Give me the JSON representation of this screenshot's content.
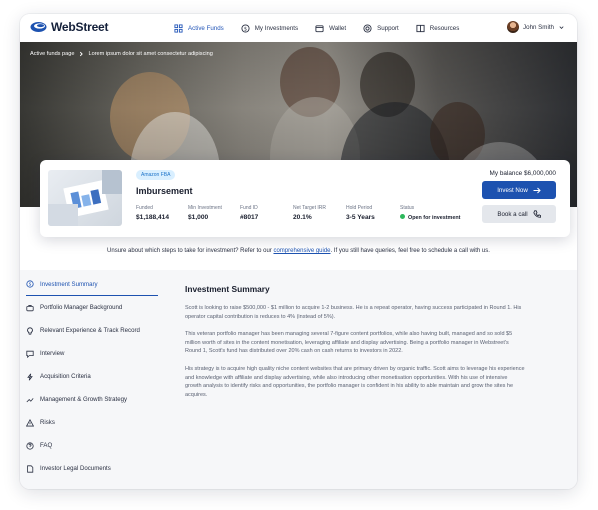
{
  "colors": {
    "brand": "#1d52b0",
    "status_open": "#2eb85c",
    "tag_bg": "#d9efff"
  },
  "nav": {
    "logo_text": "WebStreet",
    "items": [
      {
        "label": "Active Funds",
        "icon": "grid-icon",
        "active": true
      },
      {
        "label": "My Investments",
        "icon": "dollar-circle-icon"
      },
      {
        "label": "Wallet",
        "icon": "wallet-icon"
      },
      {
        "label": "Support",
        "icon": "lifebuoy-icon"
      },
      {
        "label": "Resources",
        "icon": "book-icon"
      }
    ],
    "user_name": "John Smith"
  },
  "breadcrumb": {
    "parent": "Active funds page",
    "current": "Lorem ipsum dolor sit amet consectetur adipiscing"
  },
  "fund": {
    "tag": "Amazon FBA",
    "title": "Imbursement",
    "stats": [
      {
        "label": "Funded",
        "value": "$1,188,414"
      },
      {
        "label": "Min Investment",
        "value": "$1,000"
      },
      {
        "label": "Fund ID",
        "value": "#8017"
      },
      {
        "label": "Net Target IRR",
        "value": "20.1%"
      },
      {
        "label": "Hold Period",
        "value": "3-5 Years"
      },
      {
        "label": "Status",
        "value": "Open for investment"
      }
    ],
    "balance": "My balance $6,000,000",
    "invest_label": "Invest Now",
    "call_label": "Book a call"
  },
  "info": {
    "before": "Unsure about which steps to take for investment? Refer to our ",
    "link": "comprehensive guide",
    "after": ". If you still have queries, feel free to schedule a call with us."
  },
  "sidebar": {
    "items": [
      {
        "label": "Investment Summary",
        "icon": "dollar-circle-icon",
        "active": true
      },
      {
        "label": "Portfolio Manager Background",
        "icon": "briefcase-icon"
      },
      {
        "label": "Relevant Experience & Track Record",
        "icon": "lightbulb-icon"
      },
      {
        "label": "Interview",
        "icon": "chat-icon"
      },
      {
        "label": "Acquisition Criteria",
        "icon": "bolt-icon"
      },
      {
        "label": "Management & Growth Strategy",
        "icon": "trend-icon"
      },
      {
        "label": "Risks",
        "icon": "warning-icon"
      },
      {
        "label": "FAQ",
        "icon": "question-icon"
      },
      {
        "label": "Investor Legal Documents",
        "icon": "document-icon"
      }
    ]
  },
  "content": {
    "heading": "Investment Summary",
    "paragraphs": [
      "Scott is looking to raise $500,000 - $1 million to acquire 1-2 business. He is a repeat operator, having success participated in Round 1. His operator capital contribution is reduces to 4% (instead of 5%).",
      "This veteran portfolio manager has been managing several 7-figure content portfolios, while also having built, managed and so sold $5 million worth of sites in the content monetisation, leveraging affiliate and display advertising. Being a portfolio manager in Webstreet's Round 1, Scott's fund has distributed over 20% cash on cash returns to investors in 2022.",
      "His strategy is to acquire high quality niche content websites that are primary driven by organic traffic. Scott aims to leverage his experience and knowledge with affiliate and display advertising, while also introducing other monetisation opportunities. With his use of intensive growth analysis to identify risks and opportunities, the portfolio manager is confident in his ability to able maintain and grow the sites he acquires."
    ]
  }
}
